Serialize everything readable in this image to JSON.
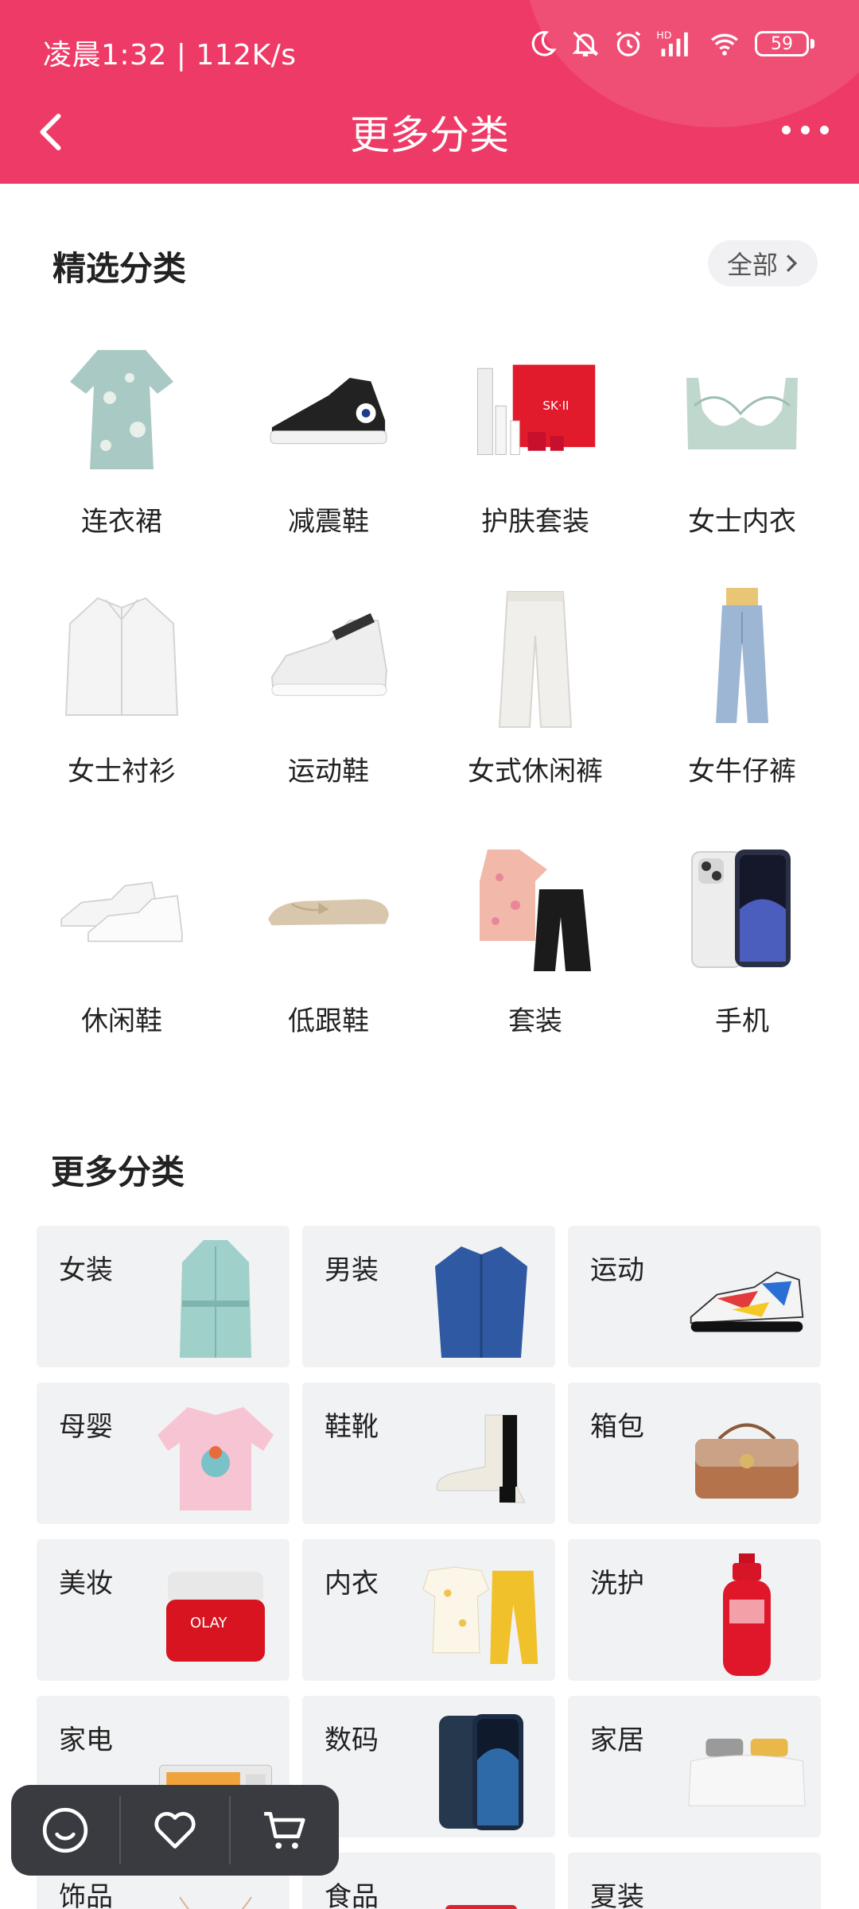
{
  "status_bar": {
    "time_speed": "凌晨1:32 | 112K/s",
    "battery": "59"
  },
  "nav": {
    "title": "更多分类"
  },
  "featured": {
    "title": "精选分类",
    "all_label": "全部",
    "items": [
      {
        "label": "连衣裙"
      },
      {
        "label": "减震鞋"
      },
      {
        "label": "护肤套装"
      },
      {
        "label": "女士内衣"
      },
      {
        "label": "女士衬衫"
      },
      {
        "label": "运动鞋"
      },
      {
        "label": "女式休闲裤"
      },
      {
        "label": "女牛仔裤"
      },
      {
        "label": "休闲鞋"
      },
      {
        "label": "低跟鞋"
      },
      {
        "label": "套装"
      },
      {
        "label": "手机"
      }
    ]
  },
  "more": {
    "title": "更多分类",
    "items": [
      {
        "label": "女装"
      },
      {
        "label": "男装"
      },
      {
        "label": "运动"
      },
      {
        "label": "母婴"
      },
      {
        "label": "鞋靴"
      },
      {
        "label": "箱包"
      },
      {
        "label": "美妆"
      },
      {
        "label": "内衣"
      },
      {
        "label": "洗护"
      },
      {
        "label": "家电"
      },
      {
        "label": "数码"
      },
      {
        "label": "家居"
      },
      {
        "label": "饰品"
      },
      {
        "label": "食品"
      },
      {
        "label": "夏装"
      }
    ]
  },
  "colors": {
    "header": "#ee3a66",
    "card_bg": "#f1f2f4",
    "float_bar": "#3a3b40"
  },
  "icons": [
    "back-icon",
    "more-icon",
    "moon-icon",
    "bell-off-icon",
    "alarm-icon",
    "signal-icon",
    "wifi-icon",
    "smile-icon",
    "heart-icon",
    "cart-icon"
  ]
}
